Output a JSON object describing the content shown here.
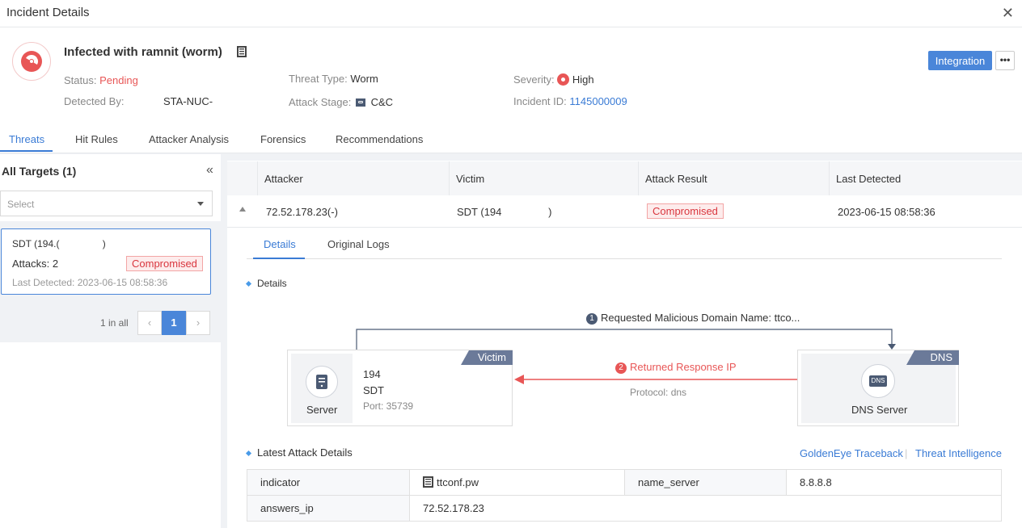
{
  "window": {
    "title": "Incident Details",
    "close_glyph": "✕"
  },
  "incident": {
    "name": "Infected with ramnit (worm)",
    "status_label": "Status:",
    "status_value": "Pending",
    "detected_by_label": "Detected By:",
    "detected_by_value": "STA-NUC-",
    "threat_type_label": "Threat Type:",
    "threat_type_value": "Worm",
    "attack_stage_label": "Attack Stage:",
    "attack_stage_value": "C&C",
    "severity_label": "Severity:",
    "severity_value": "High",
    "incident_id_label": "Incident ID:",
    "incident_id_value": "1145000009"
  },
  "actions": {
    "integration_label": "Integration",
    "more_label": "•••"
  },
  "tabs": [
    {
      "label": "Threats"
    },
    {
      "label": "Hit Rules"
    },
    {
      "label": "Attacker Analysis"
    },
    {
      "label": "Forensics"
    },
    {
      "label": "Recommendations"
    }
  ],
  "sidebar": {
    "title": "All Targets (1)",
    "collapse_glyph": "«",
    "select_placeholder": "Select",
    "card": {
      "target": "SDT (194.(                )",
      "attacks": "Attacks: 2",
      "result": "Compromised",
      "last_detected": "Last Detected: 2023-06-15 08:58:36"
    },
    "pager": {
      "summary": "1 in all",
      "prev": "‹",
      "page": "1",
      "next": "›"
    }
  },
  "table": {
    "headers": [
      "Attacker",
      "Victim",
      "Attack Result",
      "Last Detected"
    ],
    "row": {
      "attacker": "72.52.178.23(-)",
      "victim": "SDT (194                )",
      "result": "Compromised",
      "last_detected": "2023-06-15 08:58:36"
    }
  },
  "subtabs": [
    {
      "label": "Details"
    },
    {
      "label": "Original Logs"
    }
  ],
  "details": {
    "section_title": "Details",
    "step1_num": "1",
    "step1_label": "Requested Malicious Domain Name: ttco...",
    "step2_num": "2",
    "step2_label": "Returned Response IP",
    "protocol": "Protocol: dns",
    "victim": {
      "ribbon": "Victim",
      "role": "Server",
      "ip": "194",
      "name": "SDT",
      "port": "Port: 35739"
    },
    "dns": {
      "ribbon": "DNS",
      "role": "DNS Server",
      "icon_text": "DNS"
    }
  },
  "latest": {
    "title": "Latest Attack Details",
    "link1": "GoldenEye Traceback",
    "link2": "Threat Intelligence",
    "rows": [
      {
        "k1": "indicator",
        "v1": "ttconf.pw",
        "k2": "name_server",
        "v2": "8.8.8.8"
      },
      {
        "k1": "answers_ip",
        "v1": "72.52.178.23"
      }
    ]
  },
  "colors": {
    "accent": "#3a7bd5",
    "danger": "#e85656",
    "ribbon": "#6b7a99"
  }
}
